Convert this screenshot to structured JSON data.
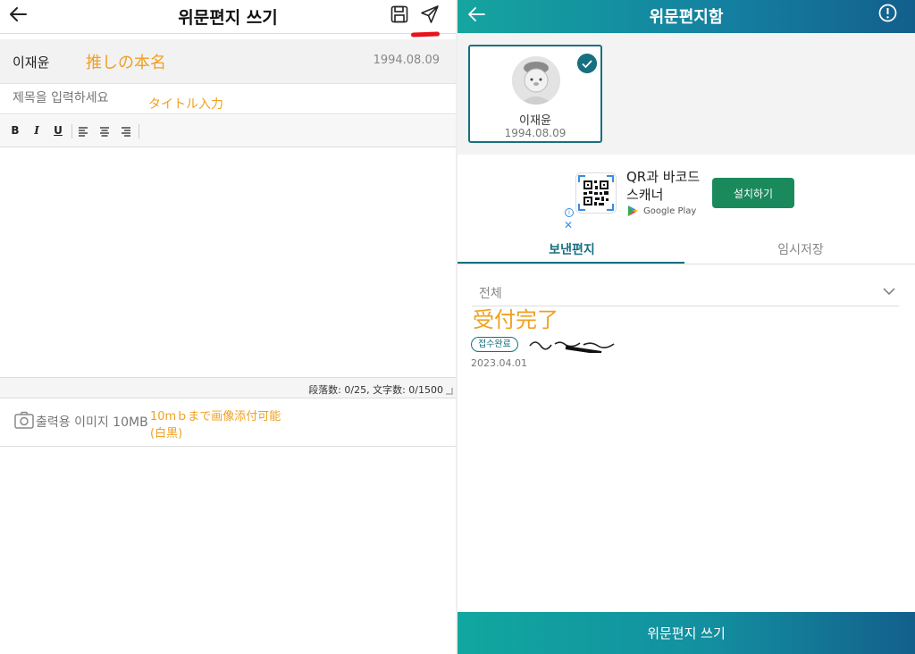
{
  "left": {
    "header": {
      "title": "위문편지 쓰기"
    },
    "recipient": {
      "name": "이재윤",
      "birthday": "1994.08.09"
    },
    "subject": {
      "placeholder": "제목을 입력하세요"
    },
    "toolbar": {
      "bold": "B",
      "italic": "I",
      "underline": "U"
    },
    "counter": "段落数: 0/25, 文字数: 0/1500",
    "attachment": {
      "label": "출력용 이미지 10MB"
    },
    "annotations": {
      "name": "推しの本名",
      "title": "タイトル入力",
      "image_line1": "10mｂまで画像添付可能",
      "image_line2": "(白黒)"
    },
    "colors": {
      "annotation": "#f0a020",
      "send_marker": "#e8141c"
    }
  },
  "right": {
    "header": {
      "title": "위문편지함"
    },
    "recipient_card": {
      "name": "이재윤",
      "birthday": "1994.08.09"
    },
    "ad": {
      "title": "QR과 바코드 스캐너",
      "store": "Google Play",
      "install_label": "설치하기"
    },
    "tabs": [
      {
        "label": "보낸편지"
      },
      {
        "label": "임시저장"
      }
    ],
    "filter": {
      "label": "전체"
    },
    "letters": [
      {
        "status": "접수완료",
        "date": "2023.04.01"
      }
    ],
    "annotations": {
      "received": "受付完了"
    },
    "footer": {
      "write_label": "위문편지 쓰기"
    },
    "colors": {
      "accent": "#17707f",
      "header_start": "#15a59f",
      "header_end": "#135f8c",
      "install": "#1a8a5c"
    }
  }
}
